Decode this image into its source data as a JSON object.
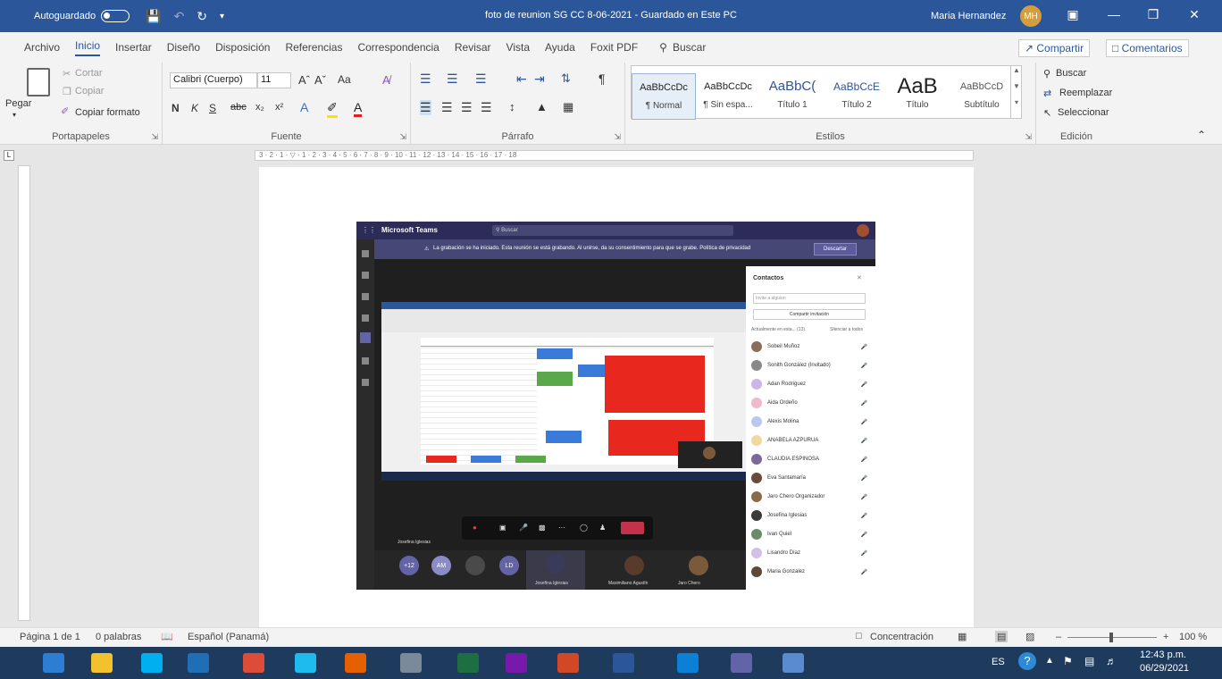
{
  "title_bar": {
    "autosave_label": "Autoguardado",
    "document_title": "foto de reunion SG CC 8-06-2021  -  Guardado en Este PC",
    "user_name": "Maria Hernandez",
    "user_initials": "MH"
  },
  "menu": {
    "items": [
      "Archivo",
      "Inicio",
      "Insertar",
      "Diseño",
      "Disposición",
      "Referencias",
      "Correspondencia",
      "Revisar",
      "Vista",
      "Ayuda",
      "Foxit PDF"
    ],
    "search_label": "Buscar",
    "share_label": "Compartir",
    "comments_label": "Comentarios"
  },
  "ribbon": {
    "clipboard": {
      "paste": "Pegar",
      "cut": "Cortar",
      "copy": "Copiar",
      "format_painter": "Copiar formato",
      "label": "Portapapeles"
    },
    "font": {
      "name": "Calibri (Cuerpo)",
      "size": "11",
      "case": "Aa",
      "bold": "N",
      "italic": "K",
      "underline": "S",
      "strike": "abc",
      "label": "Fuente"
    },
    "paragraph": {
      "label": "Párrafo"
    },
    "styles": {
      "label": "Estilos",
      "items": [
        {
          "preview": "AaBbCcDc",
          "name": "¶ Normal"
        },
        {
          "preview": "AaBbCcDc",
          "name": "¶ Sin espa..."
        },
        {
          "preview": "AaBbC(",
          "name": "Título 1"
        },
        {
          "preview": "AaBbCcE",
          "name": "Título 2"
        },
        {
          "preview": "AaB",
          "name": "Título"
        },
        {
          "preview": "AaBbCcD",
          "name": "Subtítulo"
        }
      ]
    },
    "editing": {
      "find": "Buscar",
      "replace": "Reemplazar",
      "select": "Seleccionar",
      "label": "Edición"
    }
  },
  "teams_screenshot": {
    "app_name": "Microsoft Teams",
    "search_placeholder": "Buscar",
    "banner": "La grabación se ha iniciado. Esta reunión se está grabando. Al unirse, da su consentimiento para que se grabe. Política de privacidad",
    "dismiss_label": "Descartar",
    "contacts_title": "Contactos",
    "invite_placeholder": "Invite a alguien",
    "share_invite": "Compartir invitación",
    "in_meeting": "Actualmente en esta... (13)",
    "silence_all": "Silenciar a todos",
    "contacts": [
      {
        "name": "Sobeil Muñoz",
        "color": "#8a6d5a"
      },
      {
        "name": "Sonith González (Invitado)",
        "color": "#888888"
      },
      {
        "name": "Adan Rodriguez",
        "color": "#c8b8e8"
      },
      {
        "name": "Aida Ordeño",
        "color": "#f0b8c8"
      },
      {
        "name": "Alexis Molina",
        "color": "#b8c8f0"
      },
      {
        "name": "ANABELA AZPURUA",
        "color": "#f0d8a0"
      },
      {
        "name": "CLAUDIA ESPINOSA",
        "color": "#7a6a9a"
      },
      {
        "name": "Eva Santamaría",
        "color": "#6a4a3a"
      },
      {
        "name": "Jaro Chero Organizador",
        "color": "#8a6a4a"
      },
      {
        "name": "Josefina Iglesias",
        "color": "#3a3a3a"
      },
      {
        "name": "Ivan Quiel",
        "color": "#6a8a6a"
      },
      {
        "name": "Lisandro Díaz",
        "color": "#d0c0e8"
      },
      {
        "name": "Maria Gonzalez",
        "color": "#5a4a3a"
      }
    ],
    "speaker_label": "Josefina Iglesias",
    "participants": [
      {
        "initials": "+12",
        "color": "#6264a7",
        "name": ""
      },
      {
        "initials": "AM",
        "color": "#8b8cc7",
        "name": ""
      },
      {
        "initials": "",
        "color": "#4a4a4a",
        "name": ""
      },
      {
        "initials": "LD",
        "color": "#6264a7",
        "name": ""
      },
      {
        "initials": "",
        "color": "#3a3a5a",
        "name": "Josefina Iglesias"
      },
      {
        "initials": "",
        "color": "#5a3a2a",
        "name": "Maximiliano Agustín"
      },
      {
        "initials": "",
        "color": "#7a5a3a",
        "name": "Jaro Chero"
      }
    ]
  },
  "status_bar": {
    "page": "Página 1 de 1",
    "words": "0 palabras",
    "language": "Español (Panamá)",
    "focus": "Concentración",
    "zoom": "100 %"
  },
  "taskbar": {
    "apps": [
      {
        "icon": "windows-start-icon",
        "color": "#2d7dd2"
      },
      {
        "icon": "file-explorer-icon",
        "color": "#f2c12e"
      },
      {
        "icon": "skype-icon",
        "color": "#00aff0"
      },
      {
        "icon": "media-player-icon",
        "color": "#1e6fb5"
      },
      {
        "icon": "chrome-icon",
        "color": "#dd4b39"
      },
      {
        "icon": "internet-explorer-icon",
        "color": "#1ebbee"
      },
      {
        "icon": "firefox-icon",
        "color": "#e66000"
      },
      {
        "icon": "tools-icon",
        "color": "#7a8a9a"
      },
      {
        "icon": "excel-icon",
        "color": "#1d6f42"
      },
      {
        "icon": "onenote-icon",
        "color": "#7719aa"
      },
      {
        "icon": "powerpoint-icon",
        "color": "#d24726"
      },
      {
        "icon": "word-icon",
        "color": "#2b579a"
      },
      {
        "icon": "edge-icon",
        "color": "#0c7fd6"
      },
      {
        "icon": "teams-icon",
        "color": "#6264a7"
      },
      {
        "icon": "paint-icon",
        "color": "#5a8acf"
      }
    ],
    "lang": "ES",
    "time": "12:43 p.m.",
    "date": "06/29/2021"
  }
}
